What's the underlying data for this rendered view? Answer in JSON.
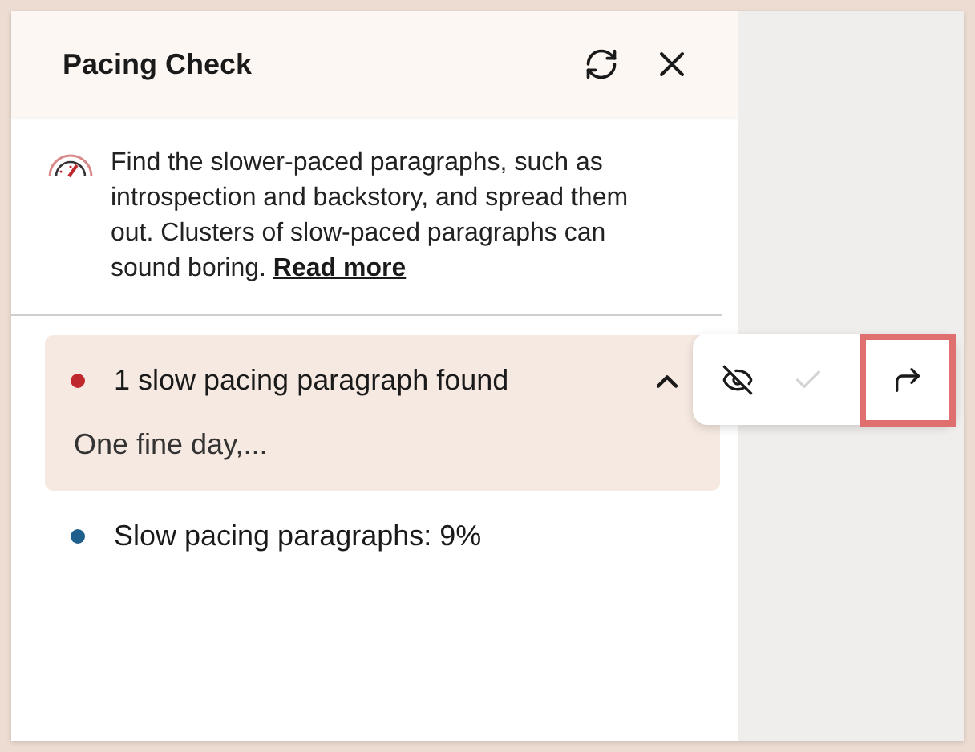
{
  "panel": {
    "title": "Pacing Check"
  },
  "intro": {
    "text": "Find the slower-paced paragraphs, such as introspection and backstory, and spread them out. Clusters of slow-paced paragraphs can sound boring.",
    "link": "Read more"
  },
  "items": [
    {
      "label": "1 slow pacing paragraph found",
      "color": "#c0282d",
      "expanded": true,
      "detail": "One fine day,..."
    },
    {
      "label": "Slow pacing paragraphs: 9%",
      "color": "#1e5f8c",
      "expanded": false
    }
  ],
  "toolbar": [
    {
      "kind": "ignore",
      "disabled": false,
      "highlighted": false
    },
    {
      "kind": "accept",
      "disabled": true,
      "highlighted": false
    },
    {
      "kind": "jump",
      "disabled": false,
      "highlighted": true
    }
  ]
}
